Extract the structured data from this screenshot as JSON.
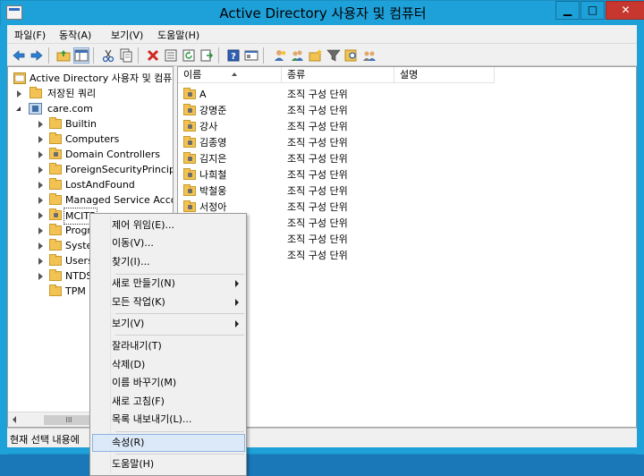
{
  "window": {
    "title": "Active Directory 사용자 및 컴퓨터",
    "minimize_glyph": "▁",
    "maximize_glyph": "□",
    "close_glyph": "✕"
  },
  "menubar": {
    "items": [
      "파일(F)",
      "동작(A)",
      "보기(V)",
      "도움말(H)"
    ]
  },
  "toolbar": {
    "icons": [
      "back-icon",
      "forward-icon",
      "up-folder-icon",
      "show-tree-icon",
      "cut-icon",
      "copy-icon",
      "delete-icon",
      "properties-icon",
      "refresh-icon",
      "export-icon",
      "help-icon",
      "console-icon",
      "add-user-icon",
      "add-group-icon",
      "add-ou-icon",
      "filter-icon",
      "find-icon",
      "delegate-icon"
    ]
  },
  "tree": {
    "root": "Active Directory 사용자 및 컴퓨",
    "saved_queries": "저장된 쿼리",
    "domain": "care.com",
    "children": [
      "Builtin",
      "Computers",
      "Domain Controllers",
      "ForeignSecurityPrincipal",
      "LostAndFound",
      "Managed Service Accou",
      "MCITP",
      "Progra",
      "Syster",
      "Users",
      "NTDS",
      "TPM D"
    ]
  },
  "list": {
    "columns": [
      "이름",
      "종류",
      "설명"
    ],
    "rows": [
      {
        "name": "A",
        "type": "조직 구성 단위"
      },
      {
        "name": "강명준",
        "type": "조직 구성 단위"
      },
      {
        "name": "강사",
        "type": "조직 구성 단위"
      },
      {
        "name": "김종영",
        "type": "조직 구성 단위"
      },
      {
        "name": "김지은",
        "type": "조직 구성 단위"
      },
      {
        "name": "나희철",
        "type": "조직 구성 단위"
      },
      {
        "name": "박철웅",
        "type": "조직 구성 단위"
      },
      {
        "name": "서정아",
        "type": "조직 구성 단위"
      },
      {
        "name": "",
        "type": "조직 구성 단위"
      },
      {
        "name": "",
        "type": "조직 구성 단위"
      },
      {
        "name": "",
        "type": "조직 구성 단위"
      }
    ]
  },
  "status": {
    "text": "현재 선택 내용에"
  },
  "context_menu": {
    "delegate": "제어 위임(E)...",
    "move": "이동(V)...",
    "find": "찾기(I)...",
    "new": "새로 만들기(N)",
    "all_tasks": "모든 작업(K)",
    "view": "보기(V)",
    "cut": "잘라내기(T)",
    "delete": "삭제(D)",
    "rename": "이름 바꾸기(M)",
    "refresh": "새로 고침(F)",
    "export": "목록 내보내기(L)...",
    "properties": "속성(R)",
    "help": "도움말(H)"
  },
  "scroll_thumb": "III"
}
